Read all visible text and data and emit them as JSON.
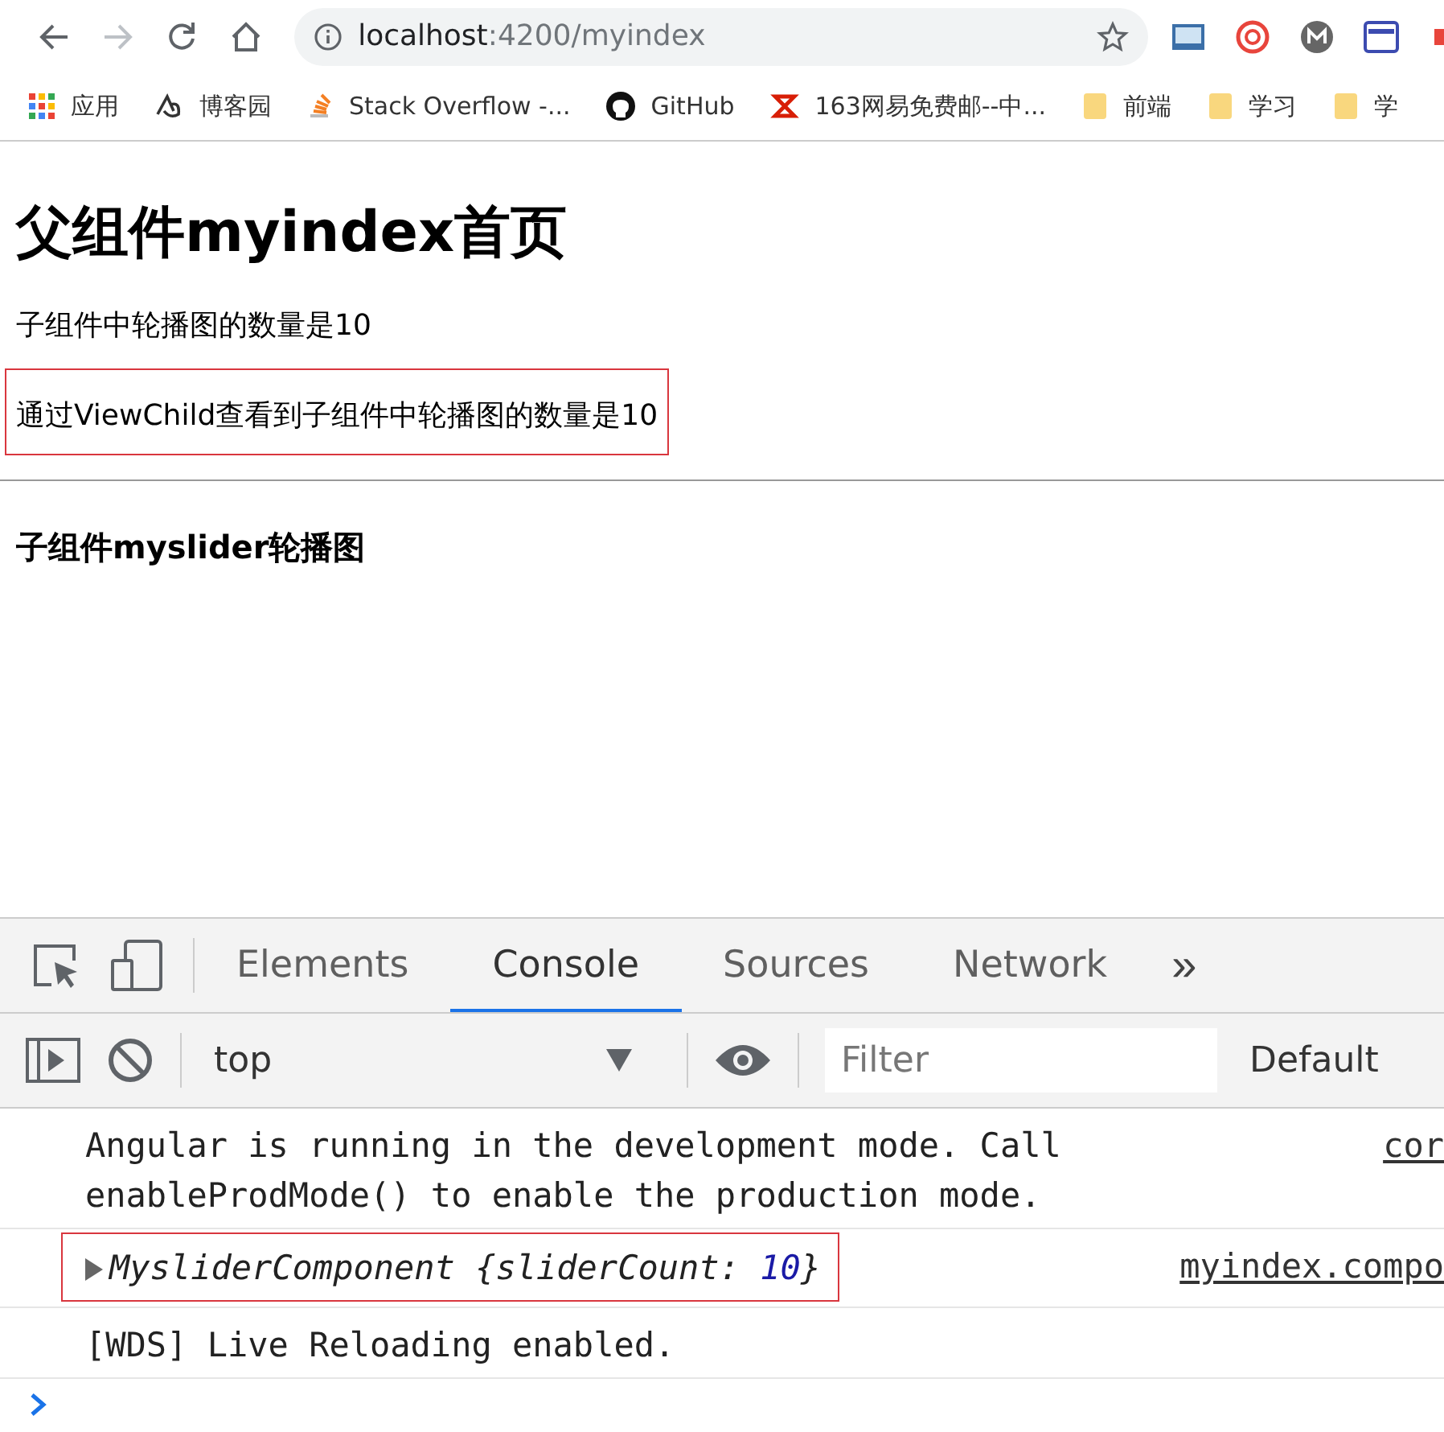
{
  "browser": {
    "url_host": "localhost",
    "url_path": ":4200/myindex",
    "forward_disabled": true
  },
  "bookmarks": [
    {
      "label": "应用",
      "kind": "apps"
    },
    {
      "label": "博客园",
      "kind": "cnblogs"
    },
    {
      "label": "Stack Overflow -...",
      "kind": "stack"
    },
    {
      "label": "GitHub",
      "kind": "github"
    },
    {
      "label": "163网易免费邮--中...",
      "kind": "mail"
    },
    {
      "label": "前端",
      "kind": "folder"
    },
    {
      "label": "学习",
      "kind": "folder"
    },
    {
      "label": "学",
      "kind": "folder"
    }
  ],
  "page": {
    "title": "父组件myindex首页",
    "paragraphs": [
      {
        "text": "子组件中轮播图的数量是10",
        "outlined": false
      },
      {
        "text": "通过ViewChild查看到子组件中轮播图的数量是10",
        "outlined": true
      }
    ],
    "child_title": "子组件myslider轮播图"
  },
  "devtools": {
    "tabs": [
      {
        "label": "Elements",
        "selected": false
      },
      {
        "label": "Console",
        "selected": true
      },
      {
        "label": "Sources",
        "selected": false
      },
      {
        "label": "Network",
        "selected": false
      }
    ],
    "more": "»",
    "context": "top",
    "filter_placeholder": "Filter",
    "levels": "Default",
    "messages": [
      {
        "parts": [
          {
            "text": "Angular is running in the development mode. Call enableProdMode() to enable the production mode.",
            "kind": "plain"
          }
        ],
        "source": "cor",
        "outlined": false,
        "expandable": false
      },
      {
        "parts": [
          {
            "text": "MysliderComponent {sliderCount: ",
            "kind": "object"
          },
          {
            "text": "10",
            "kind": "number"
          },
          {
            "text": "}",
            "kind": "object"
          }
        ],
        "source": "myindex.compo",
        "outlined": true,
        "expandable": true
      },
      {
        "parts": [
          {
            "text": "[WDS] Live Reloading enabled.",
            "kind": "plain"
          }
        ],
        "outlined": false,
        "expandable": false
      }
    ]
  }
}
